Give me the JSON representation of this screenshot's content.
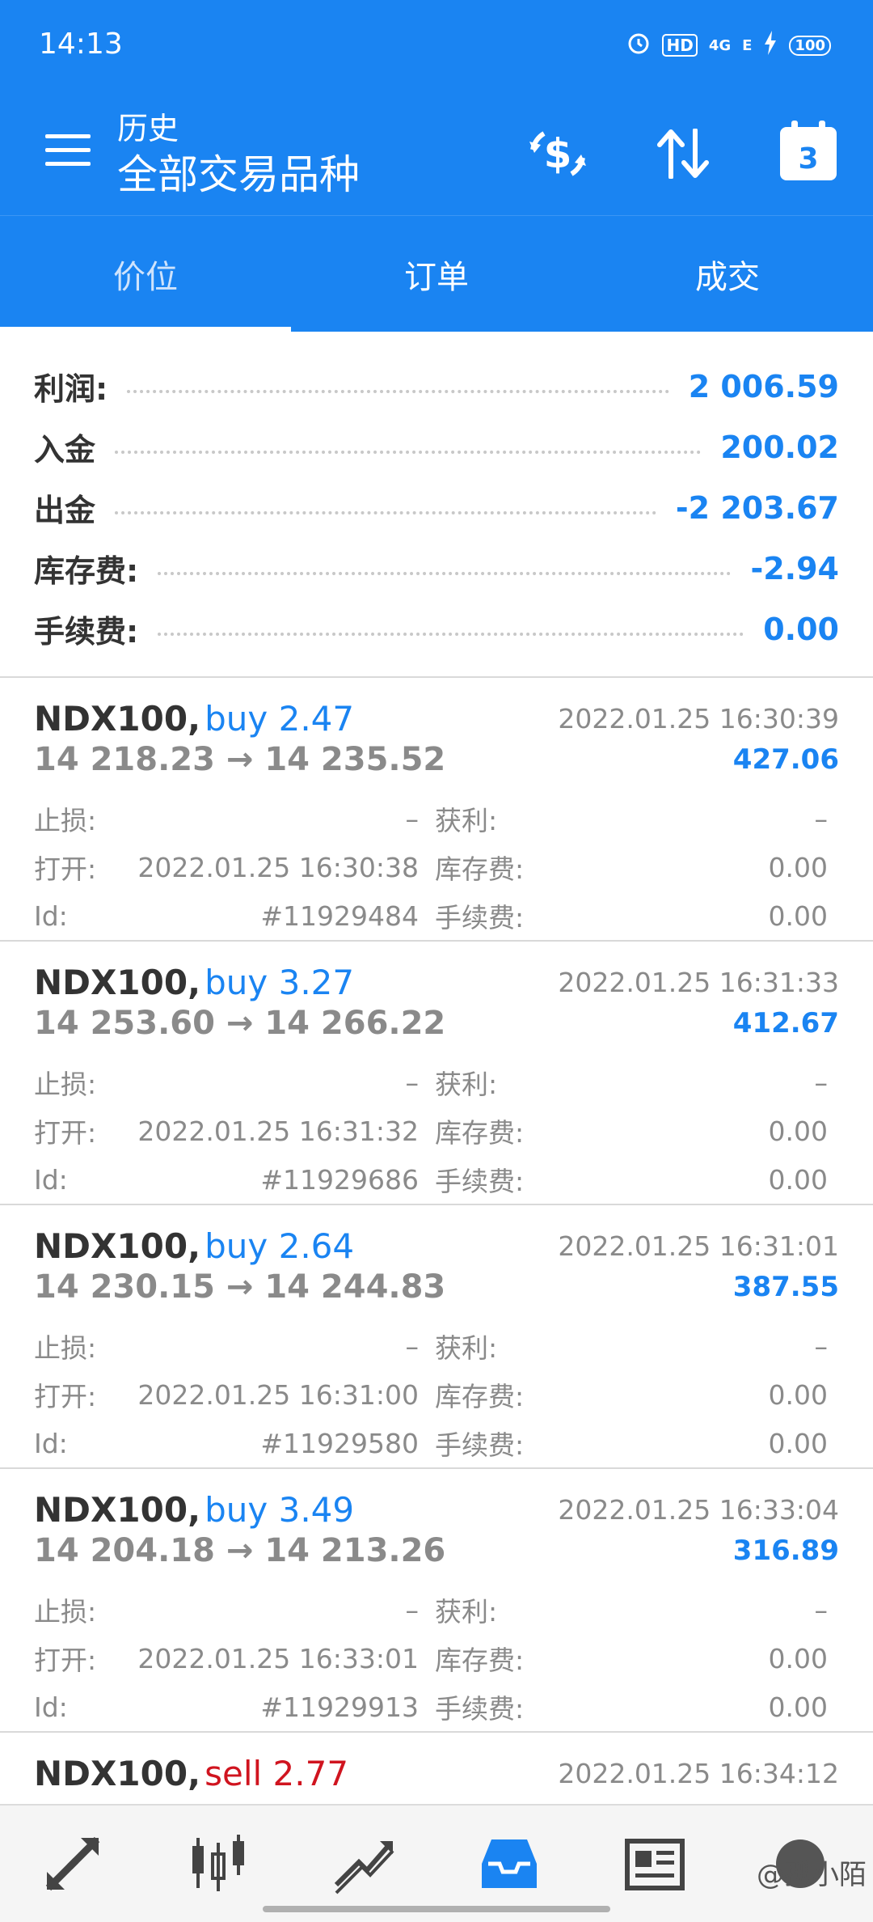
{
  "status": {
    "time": "14:13",
    "icons": [
      "alarm-icon",
      "hd-icon",
      "4g-signal-icon",
      "e-signal-icon",
      "charging-icon",
      "battery-icon"
    ],
    "hd_label": "HD",
    "net1_label": "4G",
    "net2_label": "E",
    "battery_label": "100"
  },
  "header": {
    "subtitle": "历史",
    "title": "全部交易品种",
    "calendar_day": "3",
    "background": "#1a84f2"
  },
  "tabs": [
    {
      "label": "价位",
      "active": true
    },
    {
      "label": "订单",
      "active": false
    },
    {
      "label": "成交",
      "active": false
    }
  ],
  "summary": [
    {
      "label": "利润:",
      "value": "2 006.59"
    },
    {
      "label": "入金",
      "value": "200.02"
    },
    {
      "label": "出金",
      "value": "-2 203.67"
    },
    {
      "label": "库存费:",
      "value": "-2.94"
    },
    {
      "label": "手续费:",
      "value": "0.00"
    }
  ],
  "labels": {
    "sl": "止损:",
    "tp": "获利:",
    "open": "打开:",
    "swap": "库存费:",
    "id": "Id:",
    "fee": "手续费:"
  },
  "deals": [
    {
      "symbol": "NDX100,",
      "direction": "buy 2.47",
      "type": "buy",
      "time": "2022.01.25 16:30:39",
      "prices": "14 218.23 → 14 235.52",
      "profit": "427.06",
      "sl": "–",
      "tp": "–",
      "open_time": "2022.01.25 16:30:38",
      "swap": "0.00",
      "id": "#11929484",
      "fee": "0.00"
    },
    {
      "symbol": "NDX100,",
      "direction": "buy 3.27",
      "type": "buy",
      "time": "2022.01.25 16:31:33",
      "prices": "14 253.60 → 14 266.22",
      "profit": "412.67",
      "sl": "–",
      "tp": "–",
      "open_time": "2022.01.25 16:31:32",
      "swap": "0.00",
      "id": "#11929686",
      "fee": "0.00"
    },
    {
      "symbol": "NDX100,",
      "direction": "buy 2.64",
      "type": "buy",
      "time": "2022.01.25 16:31:01",
      "prices": "14 230.15 → 14 244.83",
      "profit": "387.55",
      "sl": "–",
      "tp": "–",
      "open_time": "2022.01.25 16:31:00",
      "swap": "0.00",
      "id": "#11929580",
      "fee": "0.00"
    },
    {
      "symbol": "NDX100,",
      "direction": "buy 3.49",
      "type": "buy",
      "time": "2022.01.25 16:33:04",
      "prices": "14 204.18 → 14 213.26",
      "profit": "316.89",
      "sl": "–",
      "tp": "–",
      "open_time": "2022.01.25 16:33:01",
      "swap": "0.00",
      "id": "#11929913",
      "fee": "0.00"
    },
    {
      "symbol": "NDX100,",
      "direction": "sell 2.77",
      "type": "sell",
      "time": "2022.01.25 16:34:12",
      "prices": "",
      "profit": "",
      "sl": "",
      "tp": "",
      "open_time": "",
      "swap": "",
      "id": "",
      "fee": ""
    }
  ],
  "bottom_nav": [
    {
      "icon": "quotes-icon",
      "active": false
    },
    {
      "icon": "chart-icon",
      "active": false
    },
    {
      "icon": "trade-icon",
      "active": false
    },
    {
      "icon": "history-icon",
      "active": true
    },
    {
      "icon": "news-icon",
      "active": false
    },
    {
      "icon": "messages-icon",
      "active": false
    }
  ],
  "watermark": "@孤小陌",
  "colors": {
    "accent": "#1a84f2",
    "sell": "#d0141f"
  }
}
